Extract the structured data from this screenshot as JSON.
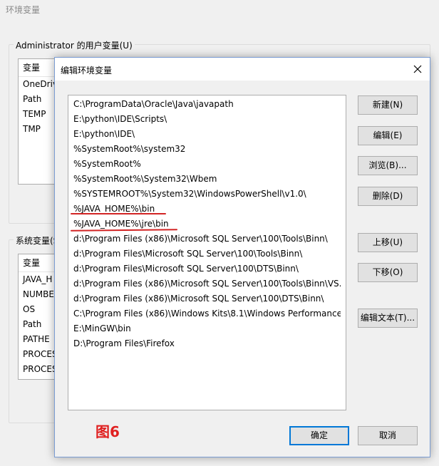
{
  "background_window": {
    "title": "环境变量",
    "user_vars_label": "Administrator 的用户变量(U)",
    "user_vars_header": "变量",
    "user_vars": [
      "OneDriv",
      "Path",
      "TEMP",
      "TMP"
    ],
    "system_vars_label": "系统变量(S",
    "system_vars_header": "变量",
    "system_vars": [
      "JAVA_H",
      "NUMBE",
      "OS",
      "Path",
      "PATHE",
      "PROCES",
      "PROCES"
    ]
  },
  "dialog": {
    "title": "编辑环境变量",
    "paths": [
      "C:\\ProgramData\\Oracle\\Java\\javapath",
      "E:\\python\\IDE\\Scripts\\",
      "E:\\python\\IDE\\",
      "%SystemRoot%\\system32",
      "%SystemRoot%",
      "%SystemRoot%\\System32\\Wbem",
      "%SYSTEMROOT%\\System32\\WindowsPowerShell\\v1.0\\",
      "%JAVA_HOME%\\bin",
      "%JAVA_HOME%\\jre\\bin",
      "d:\\Program Files (x86)\\Microsoft SQL Server\\100\\Tools\\Binn\\",
      "d:\\Program Files\\Microsoft SQL Server\\100\\Tools\\Binn\\",
      "d:\\Program Files\\Microsoft SQL Server\\100\\DTS\\Binn\\",
      "d:\\Program Files (x86)\\Microsoft SQL Server\\100\\Tools\\Binn\\VS...",
      "d:\\Program Files (x86)\\Microsoft SQL Server\\100\\DTS\\Binn\\",
      "C:\\Program Files (x86)\\Windows Kits\\8.1\\Windows Performance...",
      "E:\\MinGW\\bin",
      "D:\\Program Files\\Firefox"
    ],
    "buttons": {
      "new": "新建(N)",
      "edit": "编辑(E)",
      "browse": "浏览(B)...",
      "delete": "删除(D)",
      "move_up": "上移(U)",
      "move_down": "下移(O)",
      "edit_text": "编辑文本(T)...",
      "ok": "确定",
      "cancel": "取消"
    },
    "figure_label": "图6",
    "highlight_color": "#d22424"
  }
}
